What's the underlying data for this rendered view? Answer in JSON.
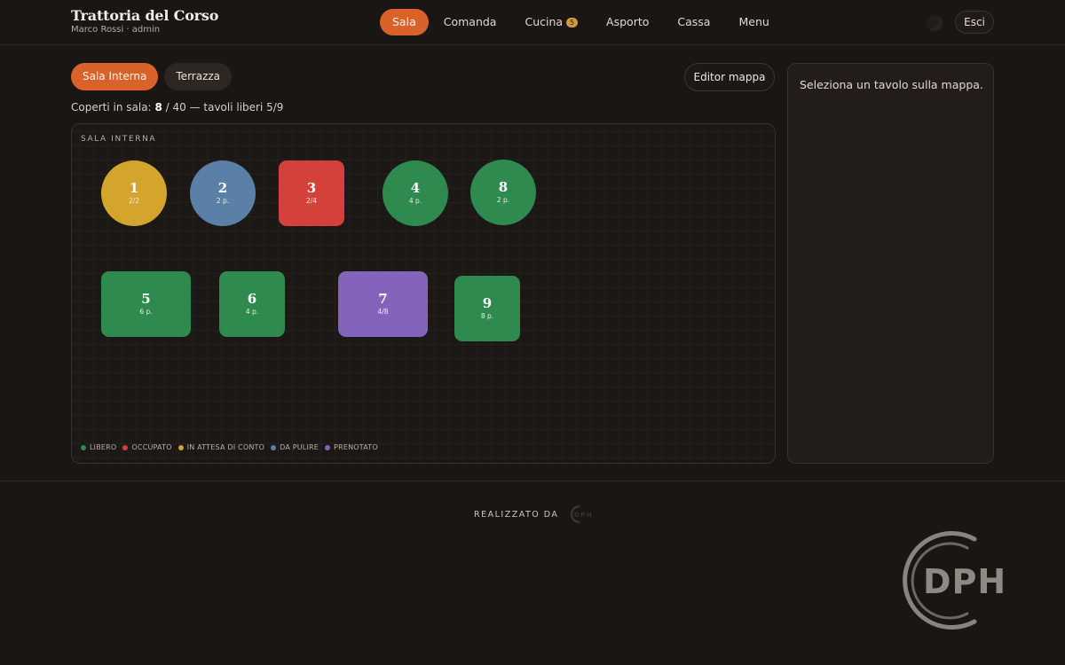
{
  "app": {
    "title": "Trattoria del Corso",
    "user": "Marco Rossi · admin"
  },
  "nav": {
    "items": [
      {
        "label": "Sala",
        "active": true
      },
      {
        "label": "Comanda"
      },
      {
        "label": "Cucina",
        "badge": "5"
      },
      {
        "label": "Asporto"
      },
      {
        "label": "Cassa"
      },
      {
        "label": "Menu"
      }
    ],
    "theme_icon": "moon-icon",
    "logout_label": "Esci"
  },
  "rooms": {
    "tabs": [
      {
        "label": "Sala Interna",
        "active": true
      },
      {
        "label": "Terrazza"
      }
    ],
    "editor_label": "Editor mappa"
  },
  "covers": {
    "prefix": "Coperti in sala:",
    "occupied": "8",
    "rest": "/ 40 — tavoli liberi 5/9"
  },
  "map": {
    "title": "SALA INTERNA",
    "tables": [
      {
        "num": "1",
        "info": "2/2",
        "status": "in-attesa-di-conto",
        "shape": "round"
      },
      {
        "num": "2",
        "info": "2 p.",
        "status": "da-pulire",
        "shape": "round"
      },
      {
        "num": "3",
        "info": "2/4",
        "status": "occupato",
        "shape": "square"
      },
      {
        "num": "4",
        "info": "4 p.",
        "status": "libero",
        "shape": "round"
      },
      {
        "num": "8",
        "info": "2 p.",
        "status": "libero",
        "shape": "round"
      },
      {
        "num": "5",
        "info": "6 p.",
        "status": "libero",
        "shape": "square"
      },
      {
        "num": "6",
        "info": "4 p.",
        "status": "libero",
        "shape": "square"
      },
      {
        "num": "7",
        "info": "4/8",
        "status": "prenotato",
        "shape": "square"
      },
      {
        "num": "9",
        "info": "8 p.",
        "status": "libero",
        "shape": "square"
      }
    ],
    "legend": [
      {
        "label": "LIBERO",
        "color": "#2e8a4e"
      },
      {
        "label": "OCCUPATO",
        "color": "#d4403a"
      },
      {
        "label": "IN ATTESA DI CONTO",
        "color": "#d3a52c"
      },
      {
        "label": "DA PULIRE",
        "color": "#5b80a8"
      },
      {
        "label": "PRENOTATO",
        "color": "#8463bd"
      }
    ]
  },
  "panel": {
    "hint": "Seleziona un tavolo sulla mappa."
  },
  "footer": {
    "credit": "REALIZZATO DA",
    "logo_text": "DPH"
  },
  "colors": {
    "accent": "#d9622b",
    "background": "#1a1614",
    "libero": "#2e8a4e",
    "occupato": "#d4403a",
    "in_attesa_di_conto": "#d3a52c",
    "da_pulire": "#5b80a8",
    "prenotato": "#8463bd"
  }
}
